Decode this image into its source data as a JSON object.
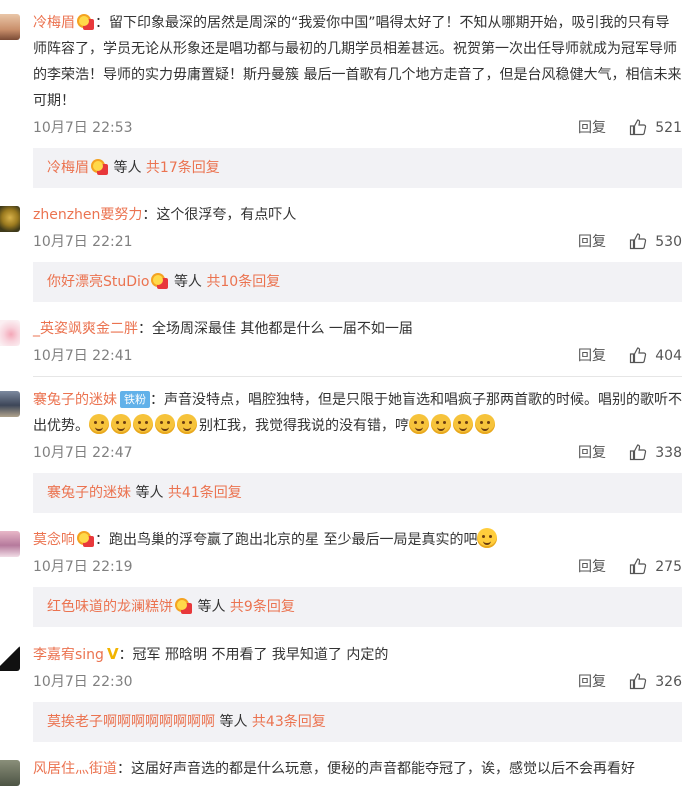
{
  "comments": [
    {
      "user": "冷梅眉",
      "badge": "vip",
      "text": "：留下印象最深的居然是周深的“我爱你中国”唱得太好了！不知从哪期开始，吸引我的只有导师阵容了，学员无论从形象还是唱功都与最初的几期学员相差甚远。祝贺第一次出任导师就成为冠军导师的李荣浩！导师的实力毋庸置疑！斯丹曼簇 最后一首歌有几个地方走音了，但是台风稳健大气，相信未来可期！",
      "time": "10月7日 22:53",
      "reply_label": "回复",
      "likes": "521",
      "replies": {
        "user": "冷梅眉",
        "suffix": "等人",
        "count": "共17条回复"
      }
    },
    {
      "user": "zhenzhen要努力",
      "text": "：这个很浮夸，有点吓人",
      "time": "10月7日 22:21",
      "reply_label": "回复",
      "likes": "530",
      "replies": {
        "user": "你好漂亮StuDio",
        "suffix": "等人",
        "count": "共10条回复"
      }
    },
    {
      "user": "_英姿飒爽金二胖",
      "text": "：全场周深最佳 其他都是什么 一届不如一届",
      "time": "10月7日 22:41",
      "reply_label": "回复",
      "likes": "404"
    },
    {
      "user": "褰兔子的迷妹",
      "fan_badge": "铁粉",
      "text_a": "：声音没特点，唱腔独特，但是只限于她盲选和唱疯子那两首歌的时候。唱别的歌听不出优势。",
      "text_b": "别杠我，我觉得我说的没有错，哼",
      "time": "10月7日 22:47",
      "reply_label": "回复",
      "likes": "338",
      "replies": {
        "user": "褰兔子的迷妹",
        "suffix": "等人",
        "count": "共41条回复"
      }
    },
    {
      "user": "莫念响",
      "badge": "vip",
      "text": "：跑出鸟巢的浮夸赢了跑出北京的星  至少最后一局是真实的吧",
      "time": "10月7日 22:19",
      "reply_label": "回复",
      "likes": "275",
      "replies": {
        "user": "红色味道的龙澜糕饼",
        "suffix": "等人",
        "count": "共9条回复"
      }
    },
    {
      "user": "李嘉宥sing",
      "v_mark": "V",
      "text": "：冠军 邢晗明 不用看了 我早知道了 内定的",
      "time": "10月7日 22:30",
      "reply_label": "回复",
      "likes": "326",
      "replies": {
        "user": "莫挨老子啊啊啊啊啊啊啊啊",
        "suffix": "等人",
        "count": "共43条回复"
      }
    },
    {
      "user": "风居住灬街道",
      "text": "：这届好声音选的都是什么玩意，便秘的声音都能夺冠了，诶，感觉以后不会再看好"
    }
  ],
  "colors": {
    "username": "#eb7350",
    "reply_bg": "#f2f2f5",
    "text": "#333333"
  },
  "icons": {
    "like": "thumbs-up-icon",
    "vip": "vip-badge-icon",
    "emoji": "dog-face-emoji"
  }
}
